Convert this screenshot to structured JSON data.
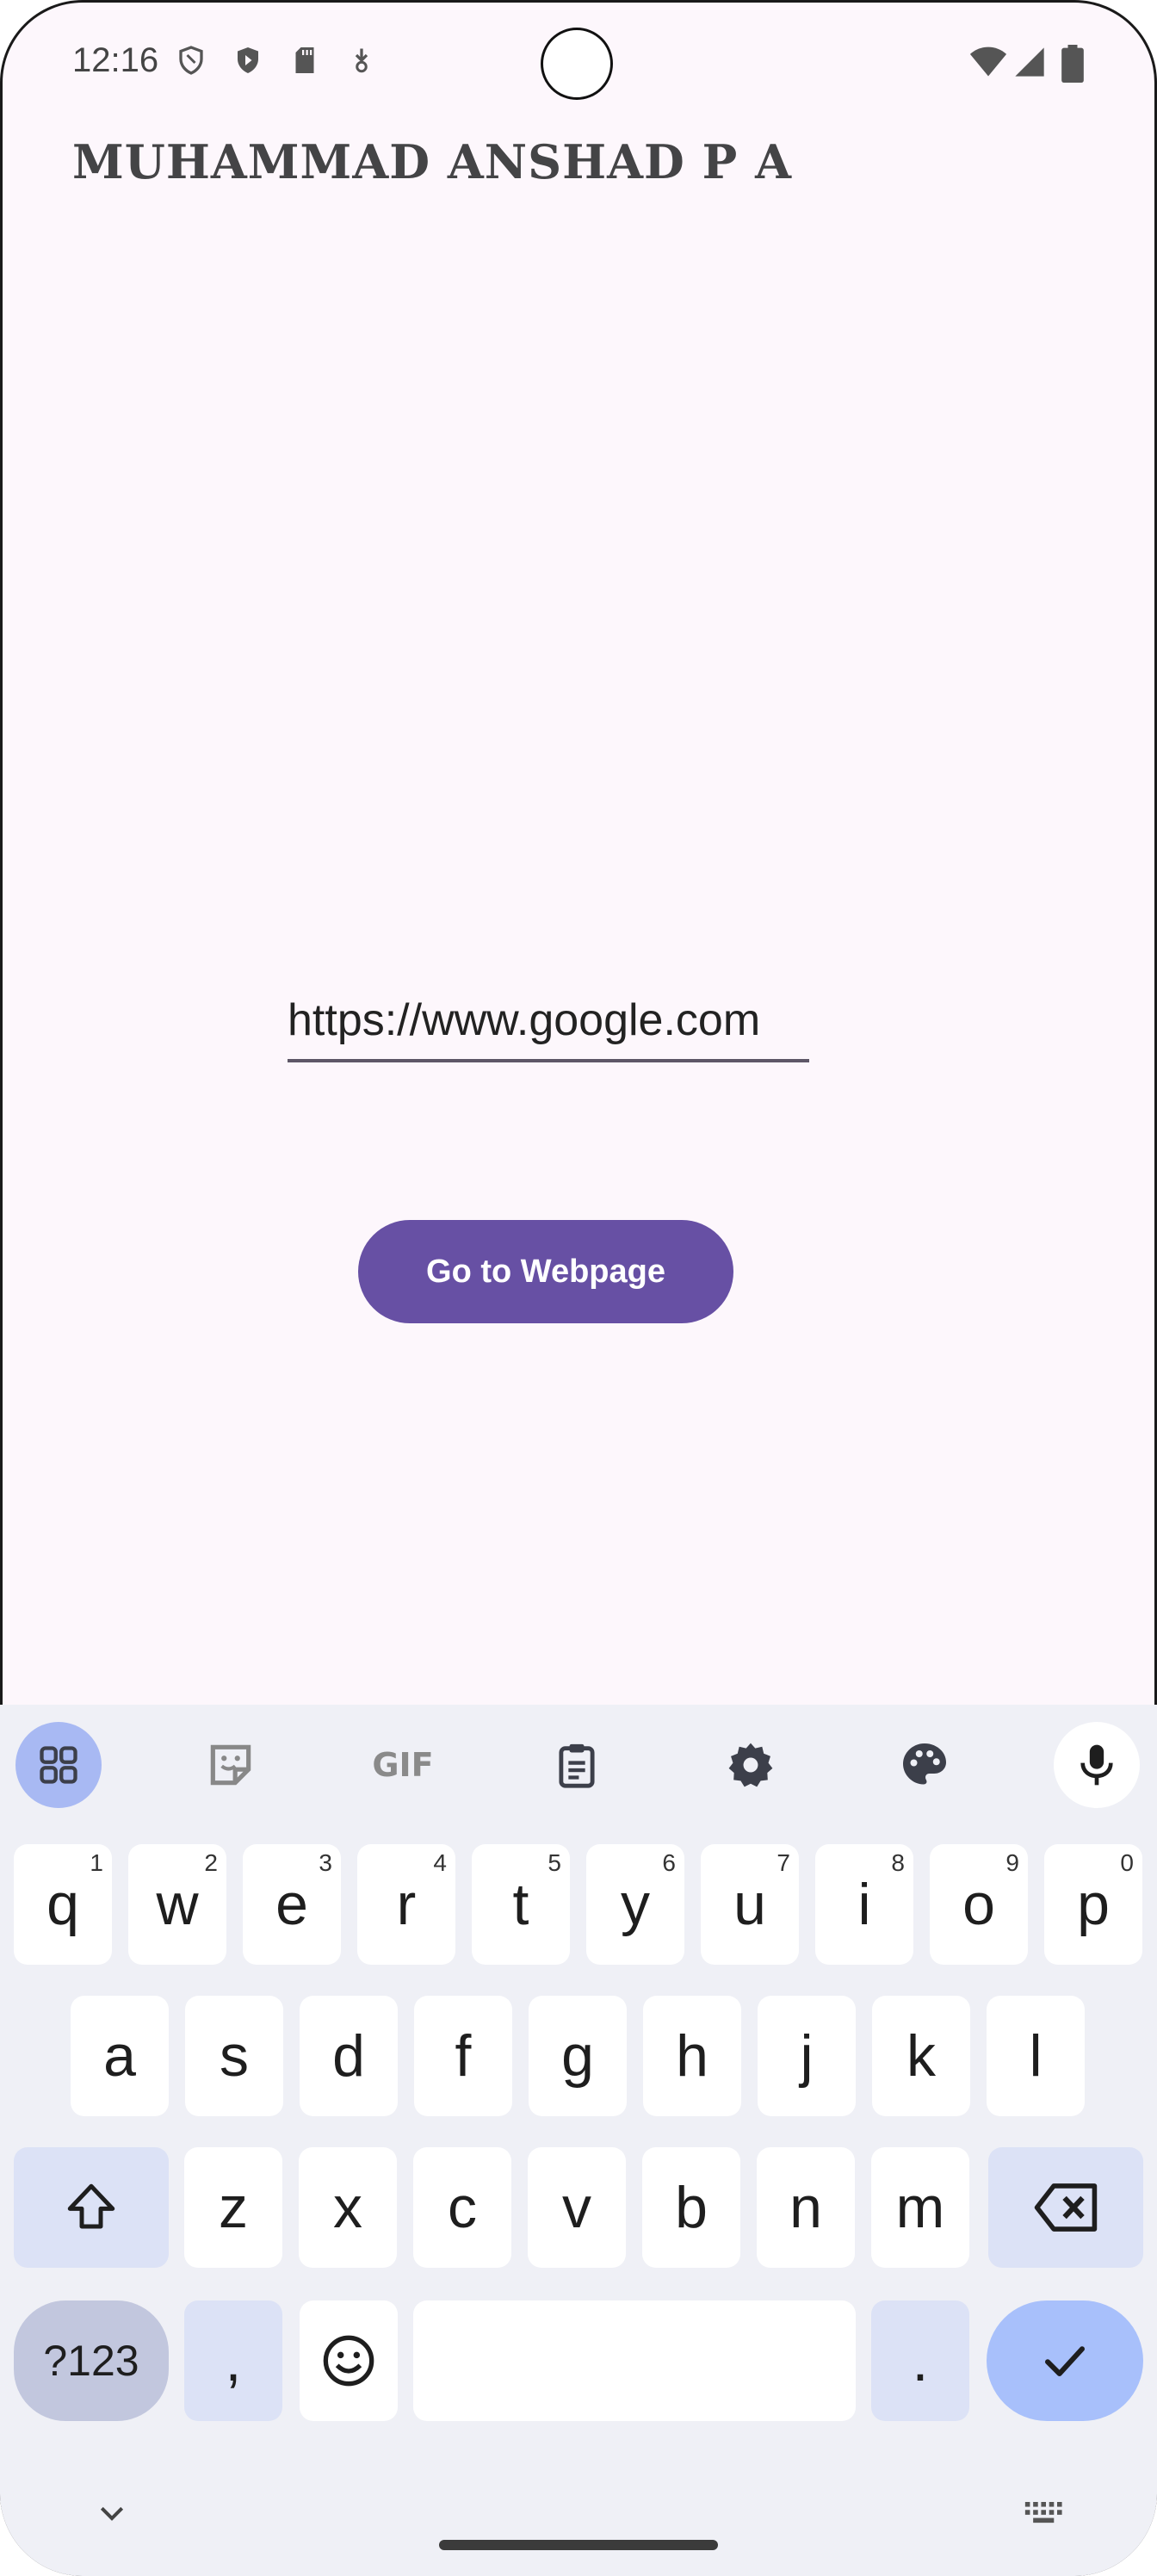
{
  "status_bar": {
    "time": "12:16",
    "left_icons": [
      "shield-outline-icon",
      "shield-play-icon",
      "sd-card-icon",
      "download-notification-icon"
    ],
    "right_icons": [
      "wifi-icon",
      "cellular-signal-icon",
      "battery-icon"
    ]
  },
  "app": {
    "title": "MUHAMMAD ANSHAD P A",
    "url_input": {
      "value": "https://www.google.com",
      "placeholder": ""
    },
    "go_button_label": "Go to Webpage",
    "colors": {
      "background": "#fdf7fc",
      "button": "#6750a4",
      "underline": "#5e5767"
    }
  },
  "keyboard": {
    "toolbar": [
      "apps-grid-icon",
      "sticker-icon",
      "gif-icon",
      "clipboard-icon",
      "settings-gear-icon",
      "palette-icon",
      "microphone-icon"
    ],
    "gif_label": "GIF",
    "row1": [
      {
        "key": "q",
        "hint": "1"
      },
      {
        "key": "w",
        "hint": "2"
      },
      {
        "key": "e",
        "hint": "3"
      },
      {
        "key": "r",
        "hint": "4"
      },
      {
        "key": "t",
        "hint": "5"
      },
      {
        "key": "y",
        "hint": "6"
      },
      {
        "key": "u",
        "hint": "7"
      },
      {
        "key": "i",
        "hint": "8"
      },
      {
        "key": "o",
        "hint": "9"
      },
      {
        "key": "p",
        "hint": "0"
      }
    ],
    "row2": [
      "a",
      "s",
      "d",
      "f",
      "g",
      "h",
      "j",
      "k",
      "l"
    ],
    "row3": [
      "z",
      "x",
      "c",
      "v",
      "b",
      "n",
      "m"
    ],
    "symbols_label": "?123",
    "comma": ",",
    "period": ".",
    "space_label": ""
  }
}
